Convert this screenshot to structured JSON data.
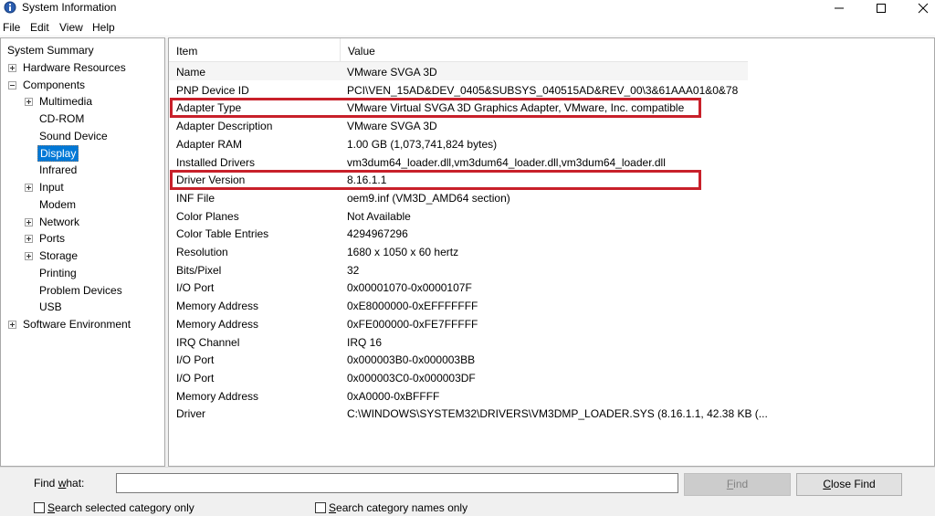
{
  "window": {
    "title": "System Information",
    "minimize_icon": "minimize-icon",
    "maximize_icon": "maximize-icon",
    "close_icon": "close-icon"
  },
  "menu": [
    "File",
    "Edit",
    "View",
    "Help"
  ],
  "tree": [
    {
      "label": "System Summary",
      "depth": 0,
      "expander": "none",
      "selected": false
    },
    {
      "label": "Hardware Resources",
      "depth": 1,
      "expander": "plus",
      "selected": false
    },
    {
      "label": "Components",
      "depth": 1,
      "expander": "minus",
      "selected": false
    },
    {
      "label": "Multimedia",
      "depth": 2,
      "expander": "plus",
      "selected": false
    },
    {
      "label": "CD-ROM",
      "depth": 2,
      "expander": "none",
      "selected": false
    },
    {
      "label": "Sound Device",
      "depth": 2,
      "expander": "none",
      "selected": false
    },
    {
      "label": "Display",
      "depth": 2,
      "expander": "none",
      "selected": true
    },
    {
      "label": "Infrared",
      "depth": 2,
      "expander": "none",
      "selected": false
    },
    {
      "label": "Input",
      "depth": 2,
      "expander": "plus",
      "selected": false
    },
    {
      "label": "Modem",
      "depth": 2,
      "expander": "none",
      "selected": false
    },
    {
      "label": "Network",
      "depth": 2,
      "expander": "plus",
      "selected": false
    },
    {
      "label": "Ports",
      "depth": 2,
      "expander": "plus",
      "selected": false
    },
    {
      "label": "Storage",
      "depth": 2,
      "expander": "plus",
      "selected": false
    },
    {
      "label": "Printing",
      "depth": 2,
      "expander": "none",
      "selected": false
    },
    {
      "label": "Problem Devices",
      "depth": 2,
      "expander": "none",
      "selected": false
    },
    {
      "label": "USB",
      "depth": 2,
      "expander": "none",
      "selected": false
    },
    {
      "label": "Software Environment",
      "depth": 1,
      "expander": "plus",
      "selected": false
    }
  ],
  "list": {
    "columns": {
      "item": "Item",
      "value": "Value"
    },
    "rows": [
      {
        "item": "Name",
        "value": "VMware SVGA 3D",
        "highlighted": false
      },
      {
        "item": "PNP Device ID",
        "value": "PCI\\VEN_15AD&DEV_0405&SUBSYS_040515AD&REV_00\\3&61AAA01&0&78",
        "highlighted": false
      },
      {
        "item": "Adapter Type",
        "value": "VMware Virtual SVGA 3D Graphics Adapter, VMware, Inc. compatible",
        "highlighted": true
      },
      {
        "item": "Adapter Description",
        "value": "VMware SVGA 3D",
        "highlighted": false
      },
      {
        "item": "Adapter RAM",
        "value": "1.00 GB (1,073,741,824 bytes)",
        "highlighted": false
      },
      {
        "item": "Installed Drivers",
        "value": "vm3dum64_loader.dll,vm3dum64_loader.dll,vm3dum64_loader.dll",
        "highlighted": false
      },
      {
        "item": "Driver Version",
        "value": "8.16.1.1",
        "highlighted": true
      },
      {
        "item": "INF File",
        "value": "oem9.inf (VM3D_AMD64 section)",
        "highlighted": false
      },
      {
        "item": "Color Planes",
        "value": "Not Available",
        "highlighted": false
      },
      {
        "item": "Color Table Entries",
        "value": "4294967296",
        "highlighted": false
      },
      {
        "item": "Resolution",
        "value": "1680 x 1050 x 60 hertz",
        "highlighted": false
      },
      {
        "item": "Bits/Pixel",
        "value": "32",
        "highlighted": false
      },
      {
        "item": "I/O Port",
        "value": "0x00001070-0x0000107F",
        "highlighted": false
      },
      {
        "item": "Memory Address",
        "value": "0xE8000000-0xEFFFFFFF",
        "highlighted": false
      },
      {
        "item": "Memory Address",
        "value": "0xFE000000-0xFE7FFFFF",
        "highlighted": false
      },
      {
        "item": "IRQ Channel",
        "value": "IRQ 16",
        "highlighted": false
      },
      {
        "item": "I/O Port",
        "value": "0x000003B0-0x000003BB",
        "highlighted": false
      },
      {
        "item": "I/O Port",
        "value": "0x000003C0-0x000003DF",
        "highlighted": false
      },
      {
        "item": "Memory Address",
        "value": "0xA0000-0xBFFFF",
        "highlighted": false
      },
      {
        "item": "Driver",
        "value": "C:\\WINDOWS\\SYSTEM32\\DRIVERS\\VM3DMP_LOADER.SYS (8.16.1.1, 42.38 KB (...",
        "highlighted": false
      }
    ]
  },
  "find": {
    "label_prefix": "Find ",
    "label_underlined": "w",
    "label_suffix": "hat:",
    "input_value": "",
    "find_button_underlined": "F",
    "find_button_rest": "ind",
    "close_button_underlined": "C",
    "close_button_rest": "lose Find",
    "check1_underlined": "S",
    "check1_rest": "earch selected category only",
    "check1_checked": false,
    "check2_underlined": "S",
    "check2_rest": "earch category names only",
    "check2_checked": false
  },
  "colors": {
    "highlight_border": "#c8202a",
    "selection": "#0078d7"
  }
}
